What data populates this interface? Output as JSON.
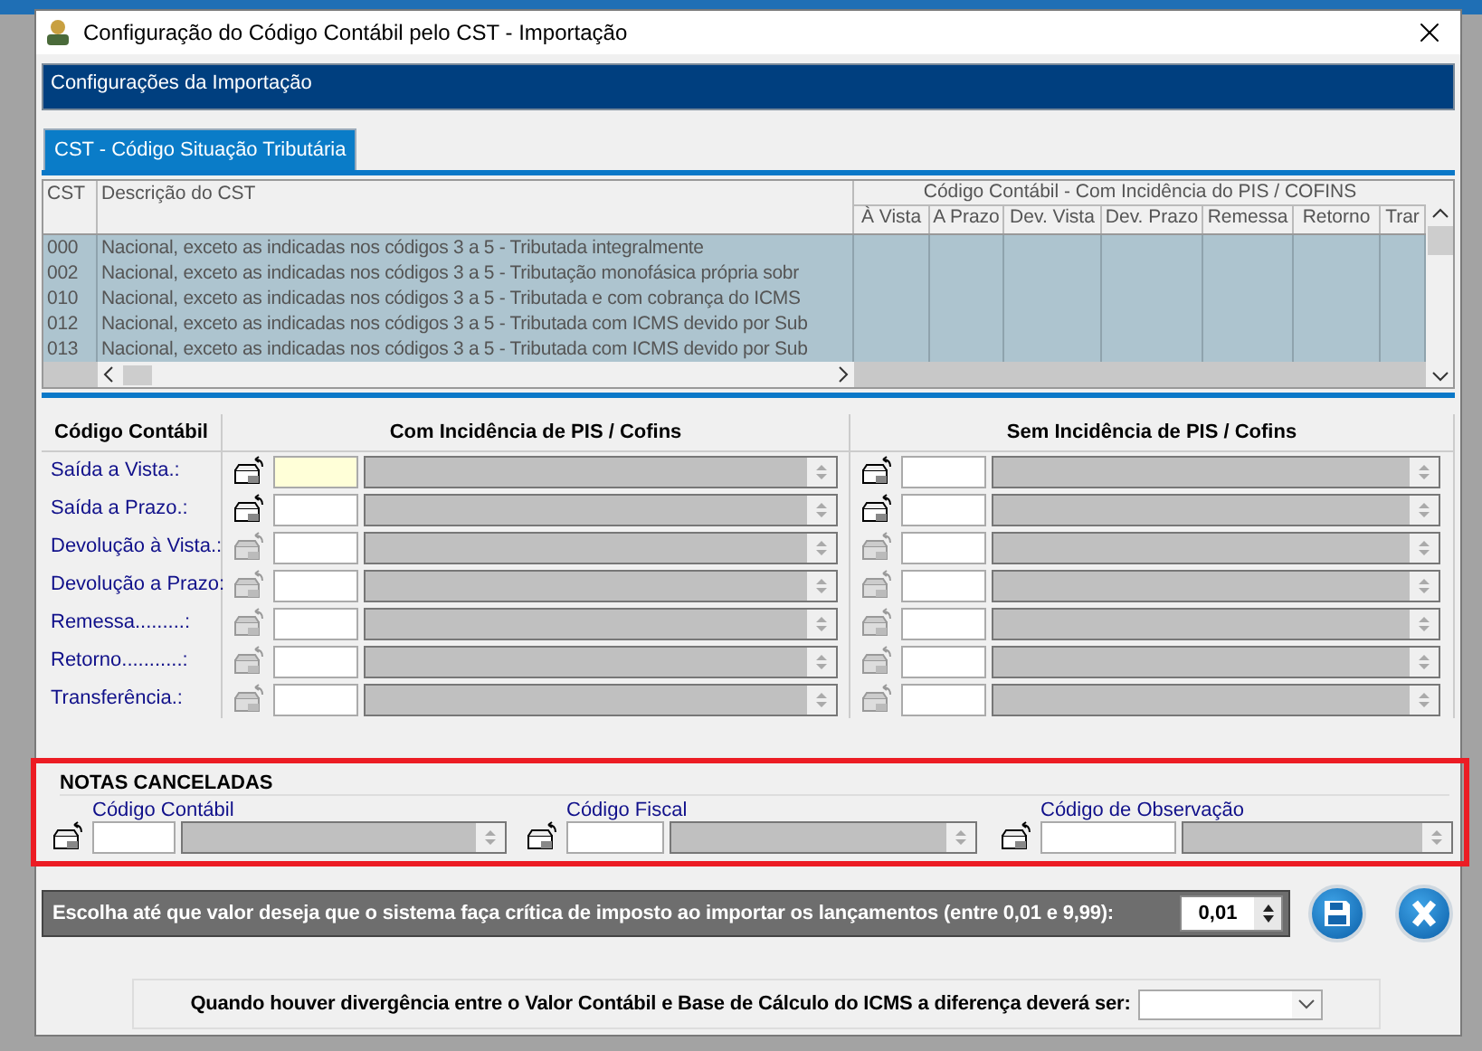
{
  "window": {
    "title": "Configuração do Código Contábil pelo CST - Importação"
  },
  "header": "Configurações da Importação",
  "tabs": [
    {
      "label": "CST - Código Situação Tributária",
      "selected": true
    }
  ],
  "cst_grid": {
    "columns": [
      "CST",
      "Descrição do CST"
    ],
    "group_header": "Código Contábil - Com Incidência do PIS / COFINS",
    "subcolumns": [
      "À Vista",
      "A Prazo",
      "Dev. Vista",
      "Dev. Prazo",
      "Remessa",
      "Retorno",
      "Trar"
    ],
    "rows": [
      {
        "cst": "000",
        "description": "Nacional, exceto as indicadas nos códigos 3 a 5 - Tributada integralmente"
      },
      {
        "cst": "002",
        "description": "Nacional, exceto as indicadas nos códigos 3 a 5 - Tributação monofásica própria sobr"
      },
      {
        "cst": "010",
        "description": "Nacional, exceto as indicadas nos códigos 3 a 5 - Tributada e com cobrança do ICMS"
      },
      {
        "cst": "012",
        "description": "Nacional, exceto as indicadas nos códigos 3 a 5 - Tributada com ICMS devido por Sub"
      },
      {
        "cst": "013",
        "description": "Nacional, exceto as indicadas nos códigos 3 a 5 - Tributada com ICMS devido por Sub"
      }
    ]
  },
  "accounts": {
    "label_header": "Código Contábil",
    "with_header": "Com Incidência de PIS / Cofins",
    "without_header": "Sem Incidência de PIS / Cofins",
    "rows": [
      {
        "label": "Saída a Vista.:",
        "enabled": true,
        "focused": true
      },
      {
        "label": "Saída a Prazo.:",
        "enabled": true,
        "focused": false
      },
      {
        "label": "Devolução à Vista.:",
        "enabled": false,
        "focused": false
      },
      {
        "label": "Devolução a Prazo:",
        "enabled": false,
        "focused": false
      },
      {
        "label": "Remessa.........:",
        "enabled": false,
        "focused": false
      },
      {
        "label": "Retorno...........:",
        "enabled": false,
        "focused": false
      },
      {
        "label": "Transferência.:",
        "enabled": false,
        "focused": false
      }
    ]
  },
  "cancelled": {
    "title": "NOTAS CANCELADAS",
    "fields": [
      {
        "label": "Código Contábil"
      },
      {
        "label": "Código Fiscal"
      },
      {
        "label": "Código de Observação"
      }
    ]
  },
  "tolerance": {
    "label": "Escolha até que valor deseja que o sistema faça crítica de imposto ao importar os lançamentos (entre 0,01 e 9,99):",
    "value": "0,01"
  },
  "divergence": {
    "label": "Quando houver divergência entre o Valor Contábil e Base de Cálculo do ICMS a diferença deverá ser:"
  }
}
